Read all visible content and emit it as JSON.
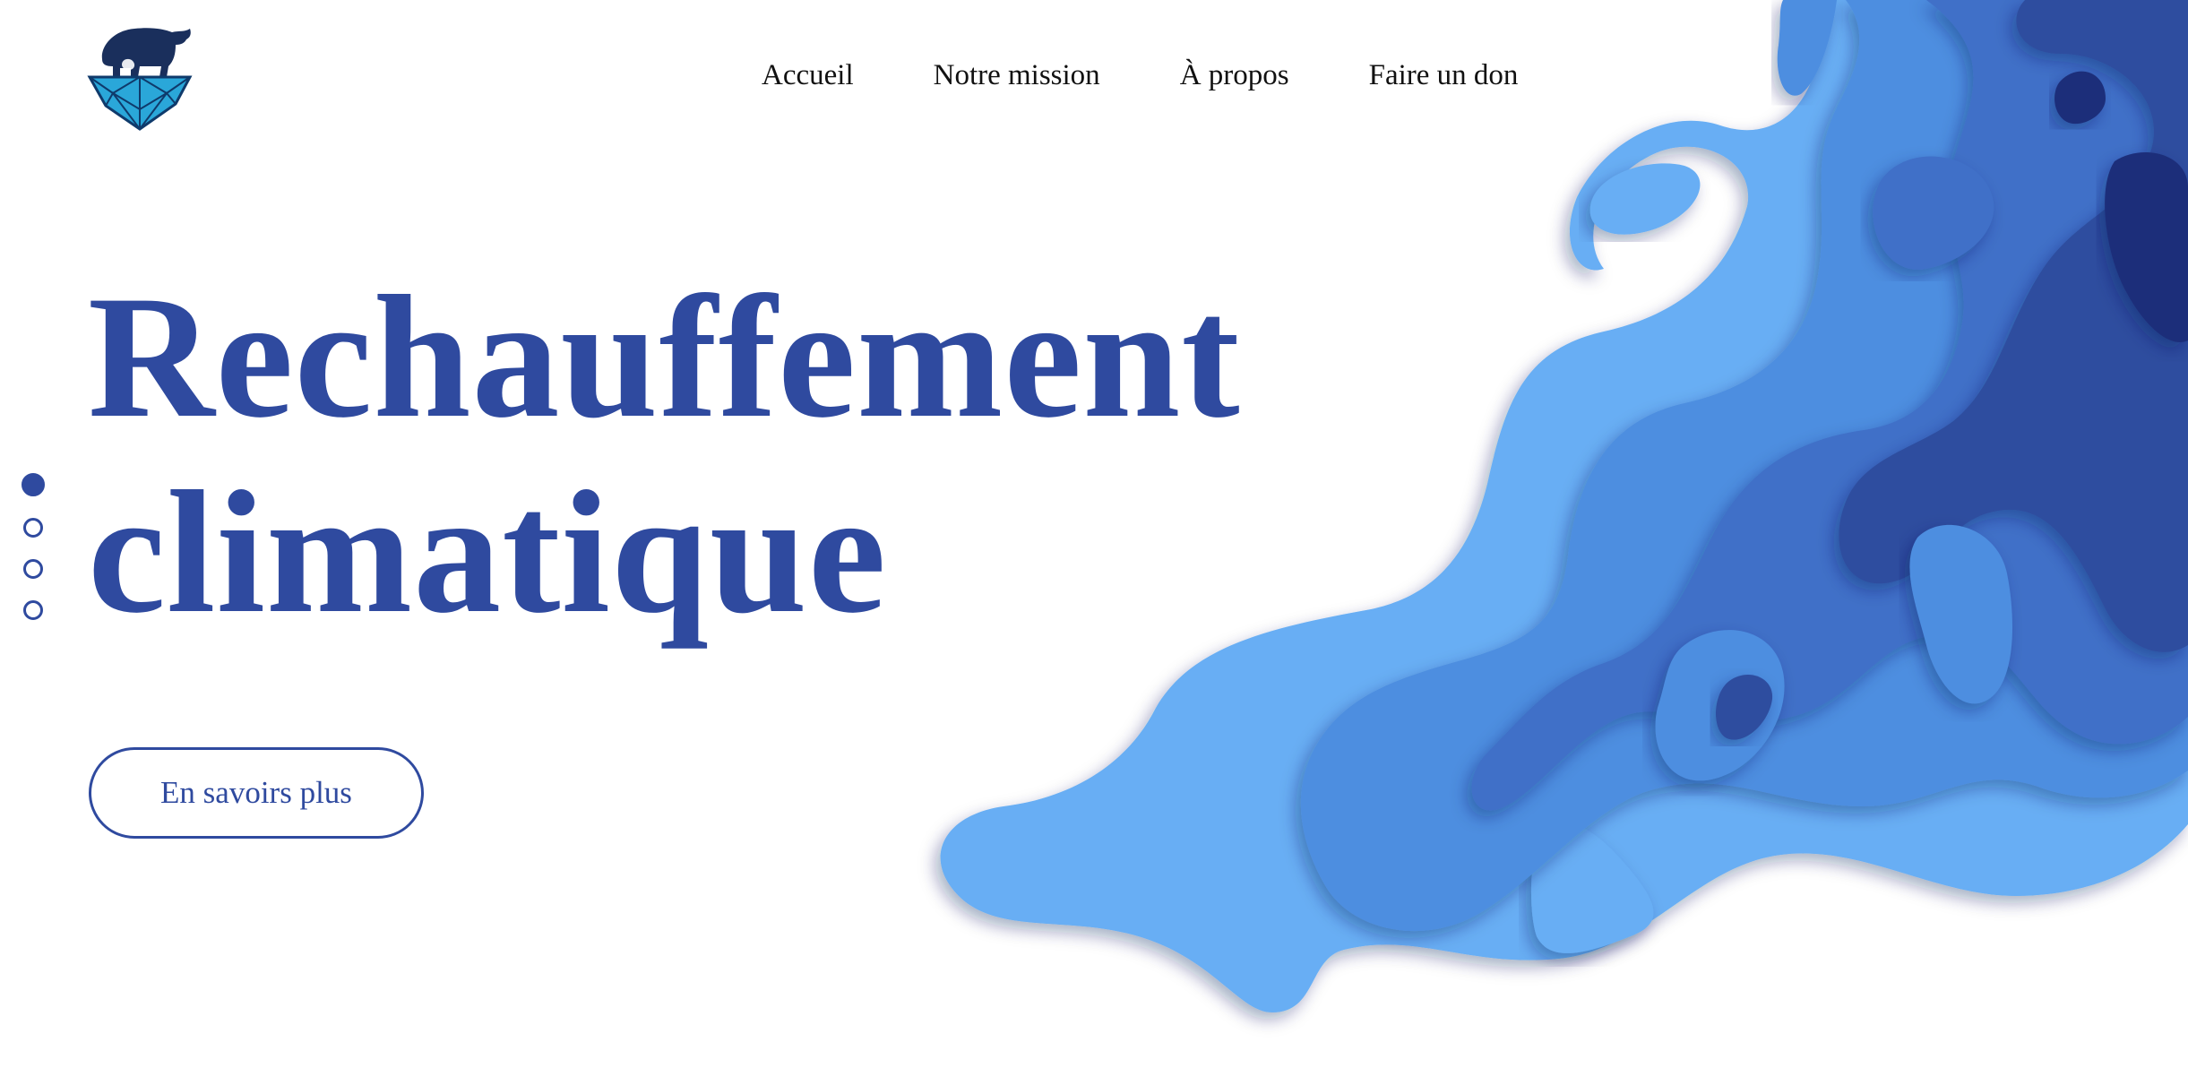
{
  "nav": {
    "items": [
      {
        "label": "Accueil"
      },
      {
        "label": "Notre mission"
      },
      {
        "label": "À propos"
      },
      {
        "label": "Faire un don"
      }
    ]
  },
  "hero": {
    "title_line1": "Rechauffement",
    "title_line2": "climatique",
    "cta_label": "En savoirs plus"
  },
  "slider": {
    "count": 4,
    "active_index": 0
  },
  "logo": {
    "icon": "polar-bear-on-ice-icon"
  },
  "colors": {
    "brand": "#2f4a9f",
    "text": "#111111",
    "light_blue": "#67aef4",
    "mid_blue": "#4d8ee0",
    "blue": "#3f70c8",
    "deep_blue": "#2e4e9f",
    "navy": "#1f2f7a"
  }
}
